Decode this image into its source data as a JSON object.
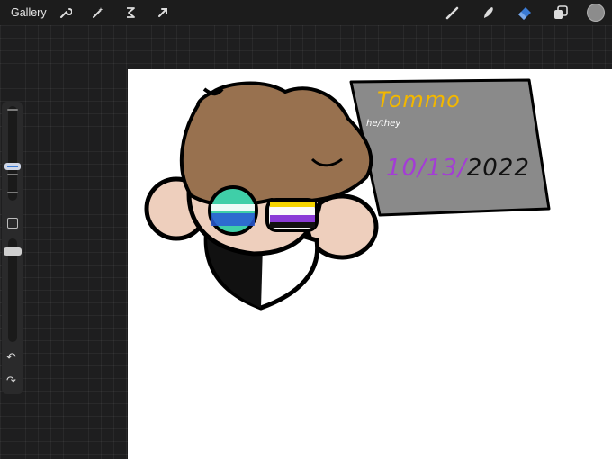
{
  "topbar": {
    "gallery_label": "Gallery",
    "left_tools": [
      "wrench-icon",
      "magic-wand-icon",
      "selection-icon",
      "transform-arrow-icon"
    ],
    "right_tools": [
      "brush-icon",
      "smudge-icon",
      "eraser-icon",
      "layers-icon"
    ],
    "active_tool": "eraser-icon",
    "current_color": "#8c8c8c",
    "accent_color": "#3a7bd5"
  },
  "sidebar": {
    "controls": [
      "brush-size-slider",
      "modify-button",
      "opacity-slider",
      "undo-icon",
      "redo-icon"
    ]
  },
  "artwork": {
    "tag_name": "Tommo",
    "tag_pronouns": "he/they",
    "tag_date_purple": "10/13/",
    "tag_date_black": "2022",
    "tag_background": "#8a8a8a"
  }
}
